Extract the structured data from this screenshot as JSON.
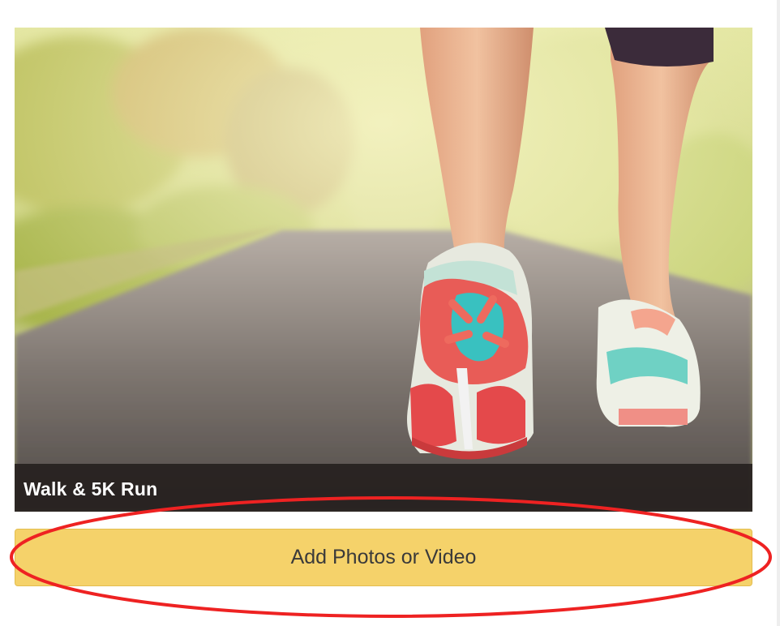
{
  "media_card": {
    "image": "walking-shoes-photo",
    "caption": "Walk & 5K Run"
  },
  "actions": {
    "add_media_label": "Add Photos or Video"
  },
  "annotation": {
    "shape": "ellipse",
    "color": "#ee2222"
  },
  "colors": {
    "button_bg": "#f5d26a",
    "caption_bg": "#231e1c",
    "annotation": "#ee2222"
  }
}
